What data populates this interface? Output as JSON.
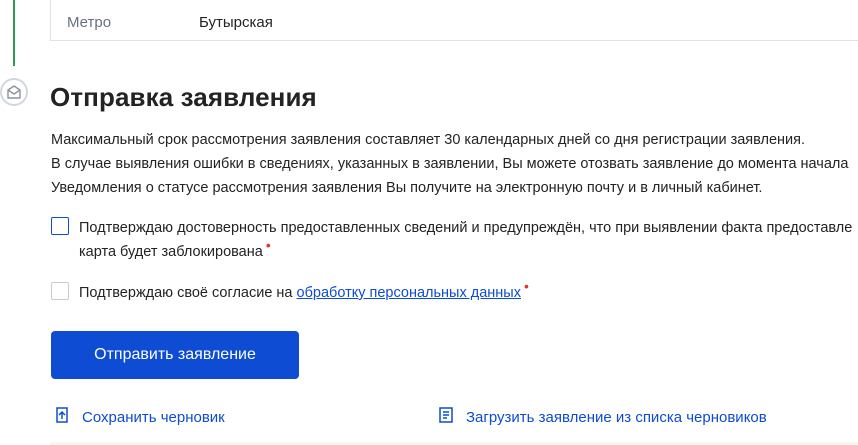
{
  "details": {
    "metro_label": "Метро",
    "metro_value": "Бутырская"
  },
  "section": {
    "icon": "envelope-icon",
    "title": "Отправка заявления",
    "info_lines": [
      "Максимальный срок рассмотрения заявления составляет 30 календарных дней со дня регистрации заявления.",
      "В случае выявления ошибки в сведениях, указанных в заявлении, Вы можете отозвать заявление до момента начала",
      "Уведомления о статусе рассмотрения заявления Вы получите на электронную почту и в личный кабинет."
    ]
  },
  "confirmations": {
    "accuracy_line1": "Подтверждаю достоверность предоставленных сведений и предупреждён, что при выявлении факта предоставле",
    "accuracy_line2": "карта будет заблокирована",
    "consent_text": "Подтверждаю своё согласие на ",
    "consent_link": "обработку персональных данных",
    "required_mark": "•"
  },
  "actions": {
    "submit_label": "Отправить заявление",
    "save_draft_label": "Сохранить черновик",
    "load_draft_label": "Загрузить заявление из списка черновиков"
  },
  "colors": {
    "accent": "#0d4cd3",
    "required": "#e1352c",
    "rail": "#2f9a52"
  }
}
